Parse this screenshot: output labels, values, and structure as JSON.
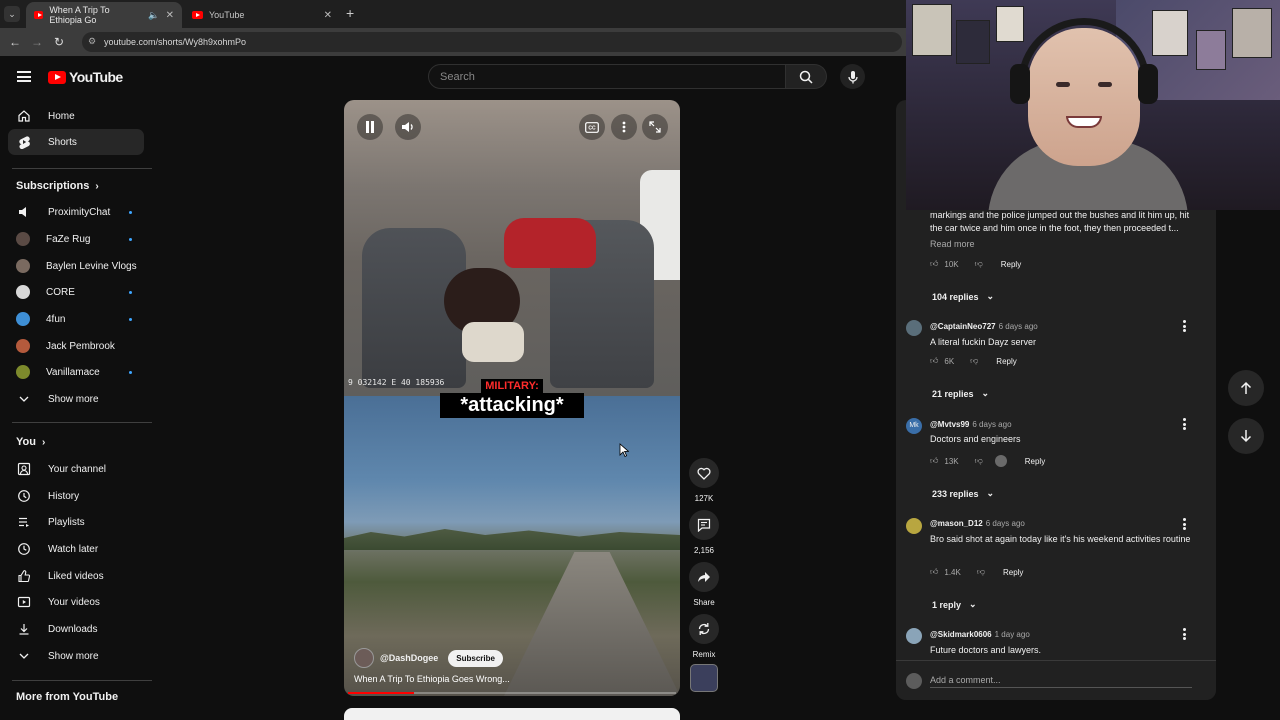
{
  "browser": {
    "tabs": [
      {
        "title": "When A Trip To Ethiopia Go",
        "active": true
      },
      {
        "title": "YouTube",
        "active": false
      }
    ],
    "url": "youtube.com/shorts/Wy8h9xohmPo"
  },
  "header": {
    "logo_text": "YouTube",
    "search_placeholder": "Search"
  },
  "sidebar": {
    "main": [
      {
        "label": "Home",
        "icon": "home-icon"
      },
      {
        "label": "Shorts",
        "icon": "shorts-icon",
        "active": true
      }
    ],
    "subscriptions_title": "Subscriptions",
    "subscriptions": [
      {
        "label": "ProximityChat",
        "color": "#3b3b3b",
        "new": true
      },
      {
        "label": "FaZe Rug",
        "color": "#5a4a44",
        "new": true
      },
      {
        "label": "Baylen Levine Vlogs",
        "color": "#7a6a60",
        "new": false
      },
      {
        "label": "CORE",
        "color": "#d8d8d8",
        "new": true
      },
      {
        "label": "4fun",
        "color": "#3e8fd6",
        "new": true
      },
      {
        "label": "Jack Pembrook",
        "color": "#b45a3c",
        "new": false
      },
      {
        "label": "Vanillamace",
        "color": "#7d8a2c",
        "new": true
      }
    ],
    "show_more_1": "Show more",
    "you_title": "You",
    "you_items": [
      {
        "label": "Your channel",
        "icon": "channel-icon"
      },
      {
        "label": "History",
        "icon": "history-icon"
      },
      {
        "label": "Playlists",
        "icon": "playlists-icon"
      },
      {
        "label": "Watch later",
        "icon": "watch-later-icon"
      },
      {
        "label": "Liked videos",
        "icon": "like-icon"
      },
      {
        "label": "Your videos",
        "icon": "your-videos-icon"
      },
      {
        "label": "Downloads",
        "icon": "download-icon"
      }
    ],
    "show_more_2": "Show more",
    "more_title": "More from YouTube"
  },
  "video": {
    "osd_text": "9 032142   E 40 185936",
    "caption_top": "MILITARY:",
    "caption_main": "*attacking*",
    "channel": "@DashDogee",
    "subscribe": "Subscribe",
    "title": "When A Trip To Ethiopia Goes Wrong...",
    "progress": 0.2
  },
  "actions": {
    "likes": "127K",
    "comments": "2,156",
    "share": "Share",
    "remix": "Remix"
  },
  "comments": {
    "first_text": "markings and the police jumped out the bushes and lit him up, hit the car twice and him once in the foot, they then proceeded t...",
    "read_more": "Read more",
    "first_likes": "10K",
    "reply_label": "Reply",
    "first_replies": "104 replies",
    "items": [
      {
        "handle": "@CaptainNeo727",
        "time": "6 days ago",
        "text": "A literal fuckin Dayz server",
        "likes": "6K",
        "replies": "21 replies",
        "avatar": "#5a6e7a"
      },
      {
        "handle": "@Mvtvs99",
        "time": "6 days ago",
        "text": "Doctors and engineers",
        "likes": "13K",
        "replies": "233 replies",
        "avatar": "#3a6ea8",
        "avatar_text": "Mk"
      },
      {
        "handle": "@mason_D12",
        "time": "6 days ago",
        "text": "Bro said shot at again today like it's his weekend activities routine",
        "likes": "1.4K",
        "replies": "1 reply",
        "avatar": "#b8a640"
      },
      {
        "handle": "@Skidmark0606",
        "time": "1 day ago",
        "text": "Future doctors and lawyers.",
        "avatar": "#8aa4b8"
      }
    ],
    "add_placeholder": "Add a comment..."
  }
}
